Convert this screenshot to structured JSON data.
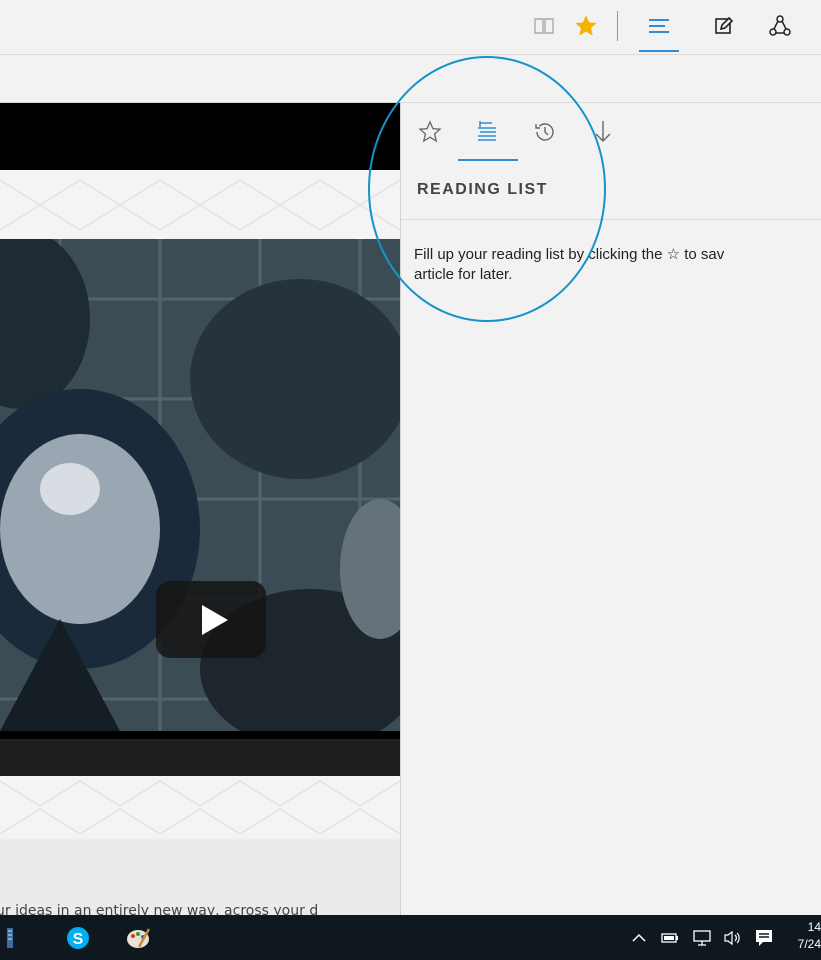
{
  "toolbar": {
    "icons": [
      "reading-view-icon",
      "favorite-star-icon",
      "hub-icon",
      "web-note-icon",
      "share-icon"
    ],
    "accent_color": "#2e8dd5",
    "star_color": "#f4b400"
  },
  "hub": {
    "tabs": [
      "favorites-icon",
      "reading-list-icon",
      "history-icon",
      "downloads-icon"
    ],
    "active_tab": "reading-list-icon",
    "title": "READING LIST",
    "message_line1": "Fill up your reading list by clicking the ☆ to sav",
    "message_line2": "article for later."
  },
  "page": {
    "bottom_text": "ur ideas in an entirely new way, across your d"
  },
  "taskbar": {
    "apps": [
      "taskbar-app-icon",
      "skype-icon",
      "paint-icon"
    ],
    "tray_icons": [
      "chevron-up-icon",
      "battery-icon",
      "network-icon",
      "volume-icon",
      "action-center-icon"
    ],
    "time": "14",
    "date": "7/24"
  }
}
